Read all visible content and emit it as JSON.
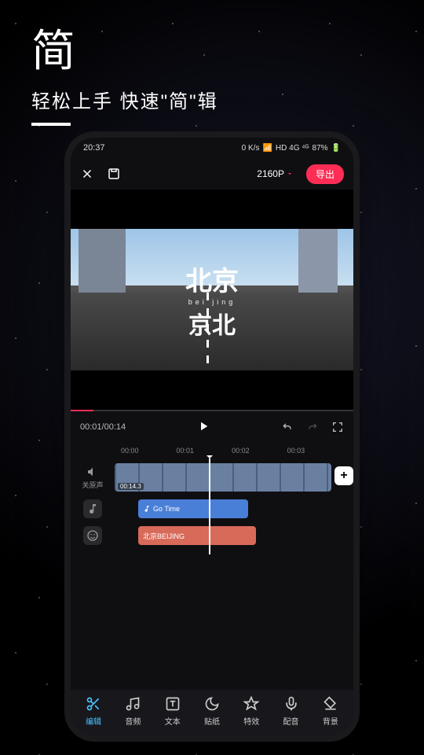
{
  "marketing": {
    "big": "简",
    "sub": "轻松上手 快速\"简\"辑"
  },
  "statusbar": {
    "time": "20:37",
    "net": "0 K/s",
    "battery": "87%"
  },
  "topbar": {
    "resolution": "2160P",
    "export": "导出"
  },
  "preview": {
    "line1": "北京",
    "pinyin": "bei   jing",
    "line2": "京北"
  },
  "playbar": {
    "time": "00:01/00:14"
  },
  "ruler": [
    "00:00",
    "00:01",
    "00:02",
    "00:03"
  ],
  "tracks": {
    "mute_label": "关原声",
    "video_duration": "00:14.3",
    "audio_name": "Go Time",
    "text_name": "北京BEIJING"
  },
  "tools": [
    {
      "id": "edit",
      "label": "编辑"
    },
    {
      "id": "audio",
      "label": "音频"
    },
    {
      "id": "text",
      "label": "文本"
    },
    {
      "id": "sticker",
      "label": "贴纸"
    },
    {
      "id": "fx",
      "label": "特效"
    },
    {
      "id": "voice",
      "label": "配音"
    },
    {
      "id": "bg",
      "label": "背景"
    }
  ]
}
